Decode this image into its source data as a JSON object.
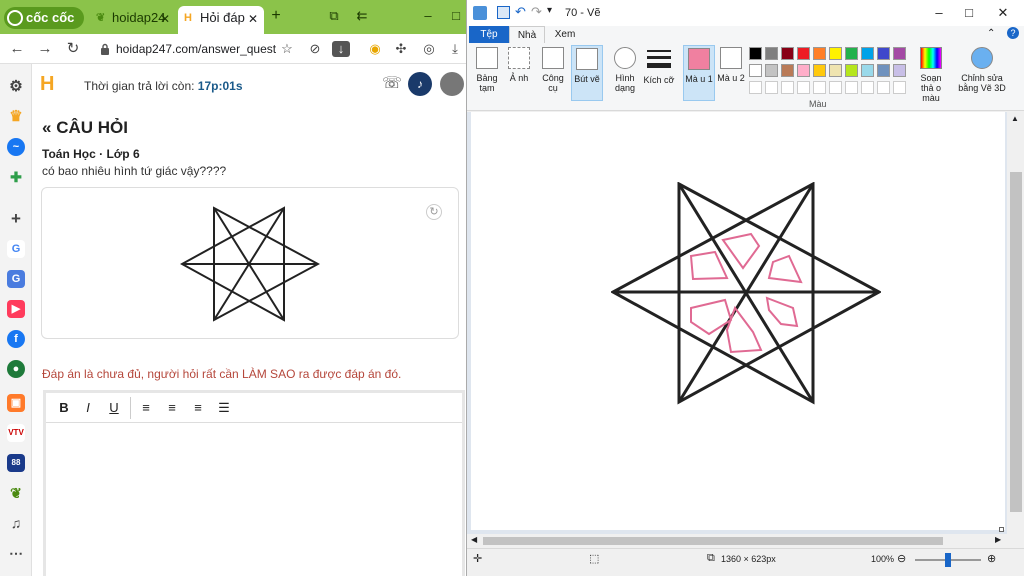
{
  "browser": {
    "logo_text": "cốc cốc",
    "tabs": [
      {
        "label": "hoidap24",
        "icon": "leaf-icon"
      },
      {
        "label": "Hỏi đáp",
        "icon": "h-logo-icon"
      }
    ],
    "new_tab": "+",
    "url": "hoidap247.com/answer_questi...",
    "window_controls": {
      "minimize": "–",
      "maximize": "□"
    }
  },
  "page": {
    "logo": "H",
    "timer_label": "Thời gian trả lời còn:",
    "timer_value": "17p:01s",
    "question_heading": "CÂU HỎI",
    "subject": "Toán Học · Lớp 6",
    "question_text": "có bao nhiêu hình tứ giác vậy????",
    "warning": "Đáp án là chưa đủ, người hỏi rất cần LÀM SAO ra được đáp án đó.",
    "editor_tools": [
      "B",
      "I",
      "U"
    ]
  },
  "paint": {
    "title": "70 - Vẽ",
    "tabs": [
      "Tệp",
      "Nhà",
      "Xem"
    ],
    "ribbon": {
      "clipboard": "Bảng tạm",
      "image": "Ả nh",
      "tools": "Công cụ",
      "brush": "Bút vẽ",
      "shapes": "Hình dạng",
      "size": "Kích cỡ",
      "color1": "Mà u 1",
      "color2": "Mà u 2",
      "edit_colors": "Soạn thả o màu",
      "paint3d": "Chỉnh sửa bằng Vẽ 3D",
      "colors_group": "Màu"
    },
    "color1_hex": "#f080a0",
    "color2_hex": "#ffffff",
    "palette": [
      "#000000",
      "#7f7f7f",
      "#880015",
      "#ed1c24",
      "#ff7f27",
      "#fff200",
      "#22b14c",
      "#00a2e8",
      "#3f48cc",
      "#a349a4",
      "#ffffff",
      "#c3c3c3",
      "#b97a57",
      "#ffaec9",
      "#ffc90e",
      "#efe4b0",
      "#b5e61d",
      "#99d9ea",
      "#7092be",
      "#c8bfe7"
    ],
    "status": {
      "dimensions": "1360 × 623px",
      "zoom": "100%"
    }
  }
}
